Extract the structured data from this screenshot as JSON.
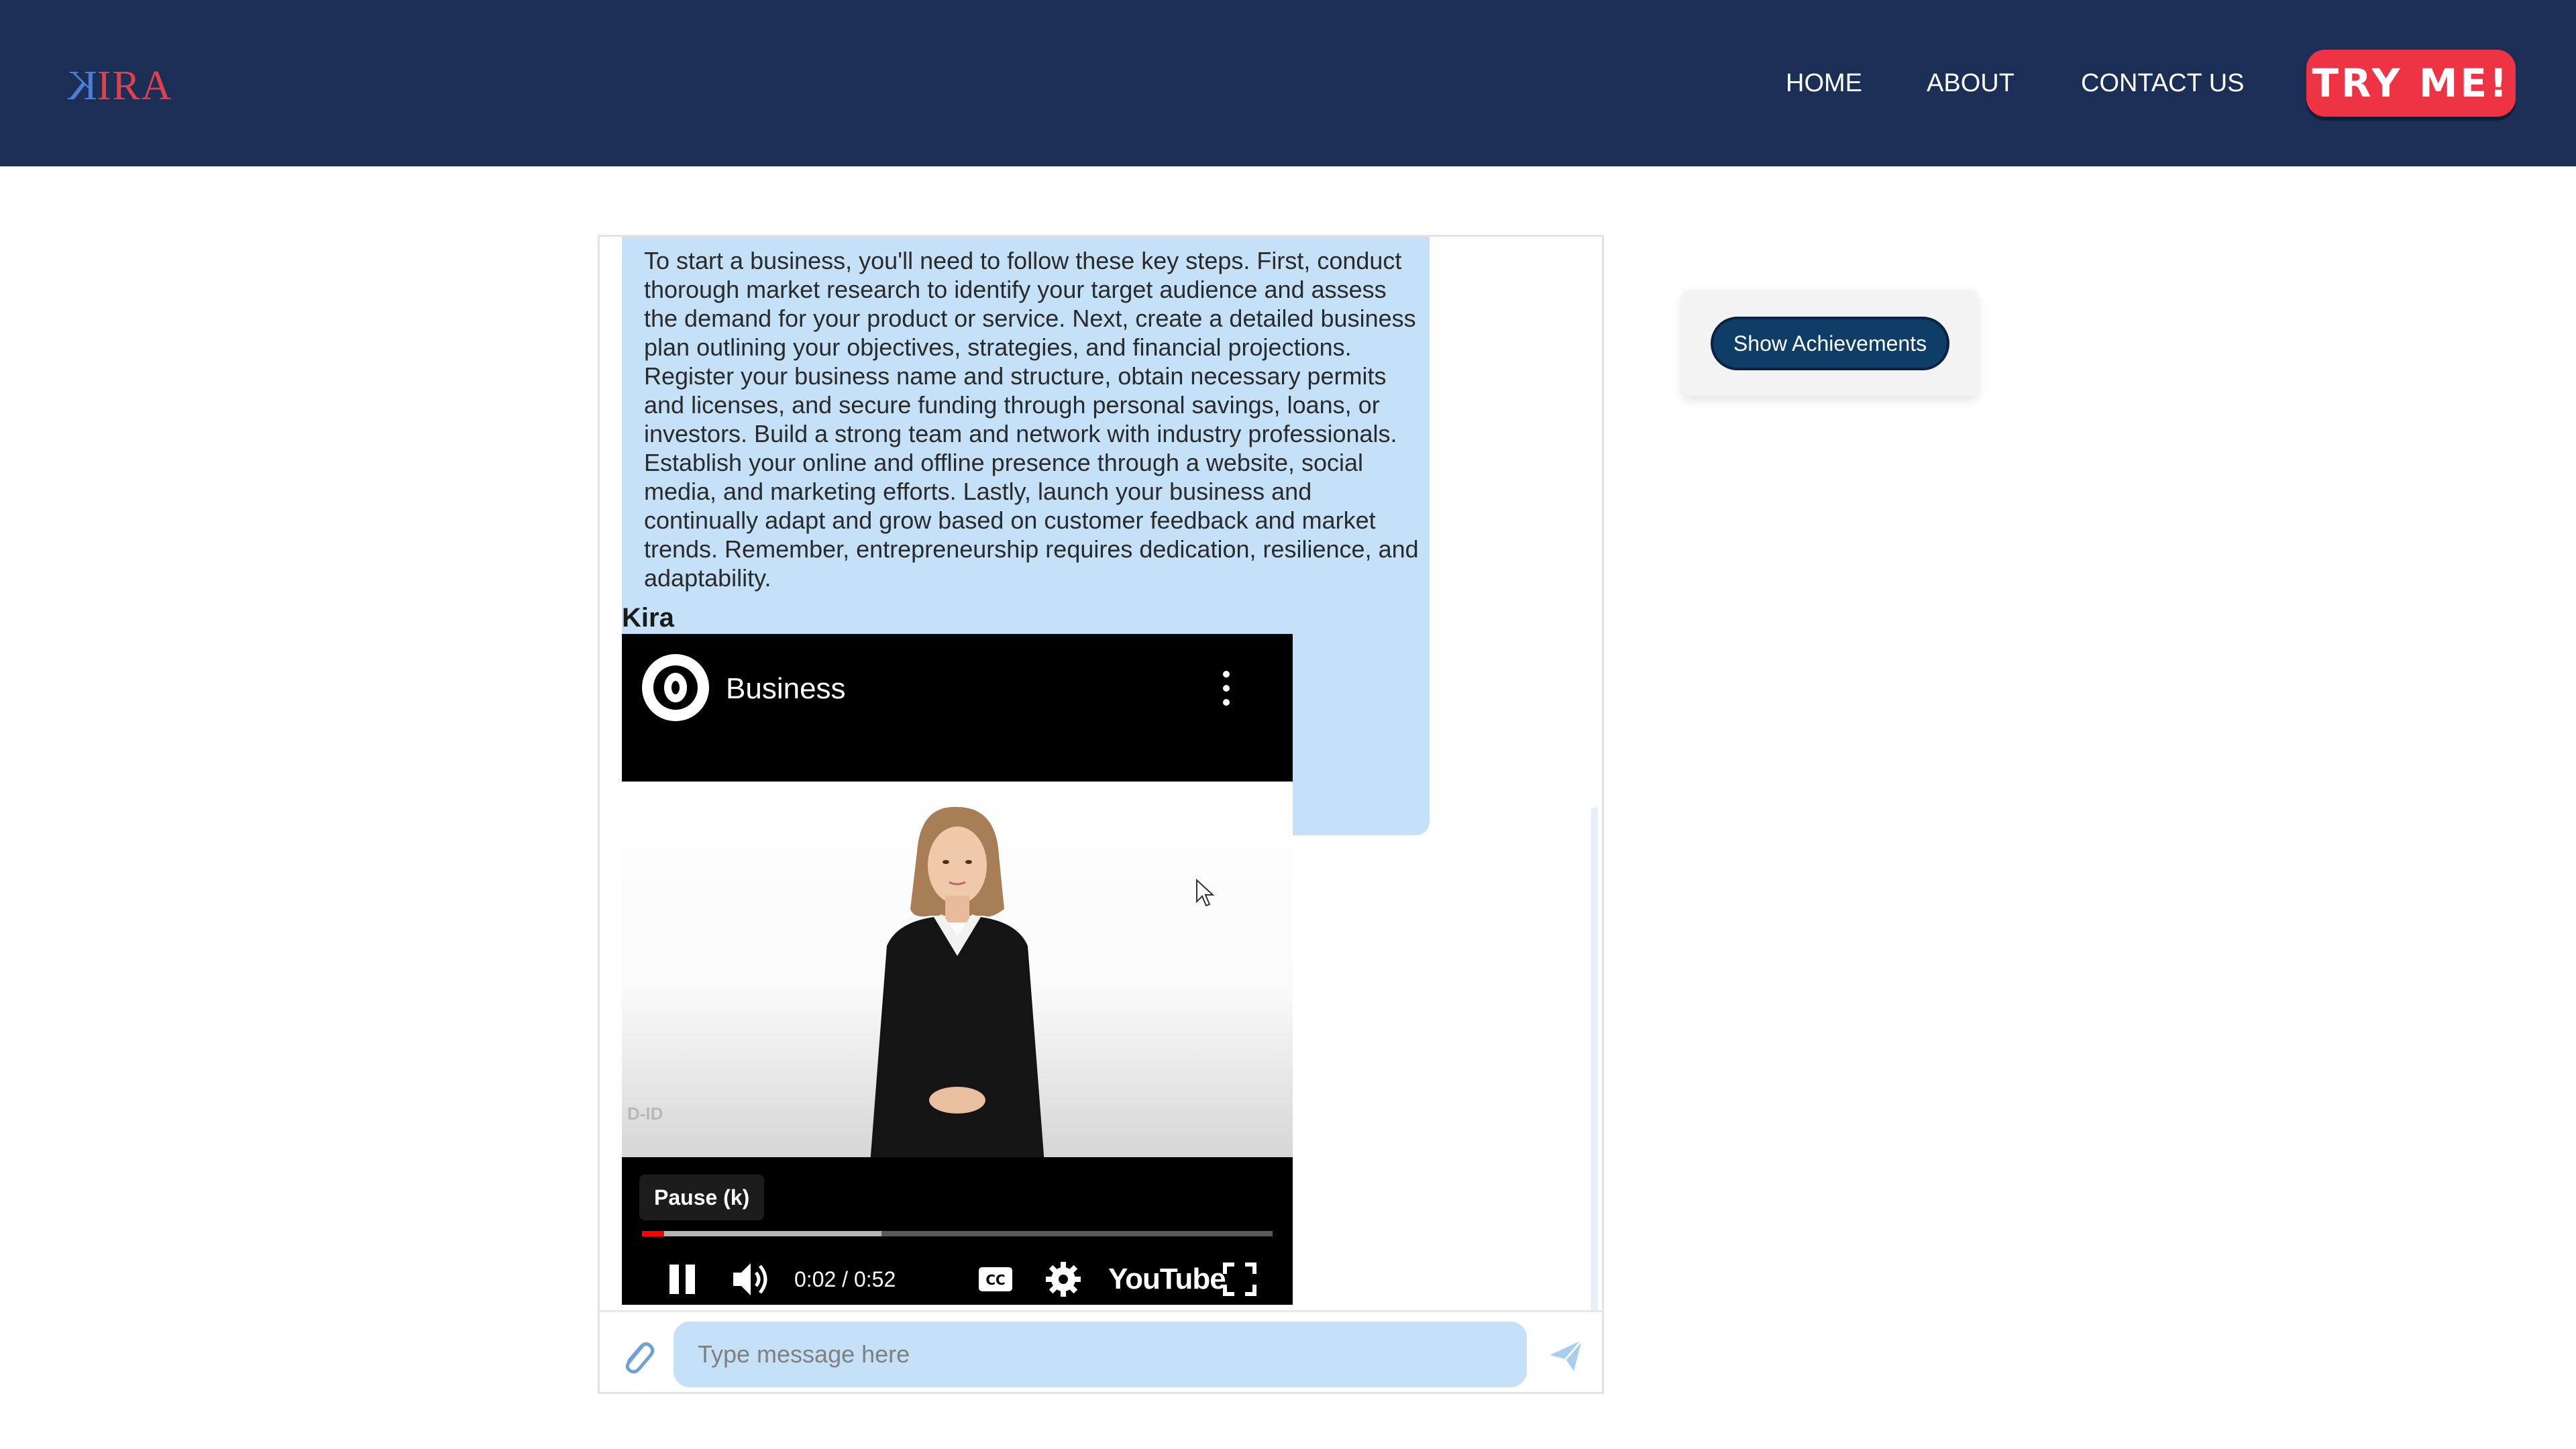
{
  "header": {
    "logo": {
      "k": "K",
      "rest": "IRA"
    },
    "nav": {
      "home": "HOME",
      "about": "ABOUT",
      "contact": "CONTACT US"
    },
    "cta_label": "TRY ME!"
  },
  "chat": {
    "bot_message": "To start a business, you'll need to follow these key steps. First, conduct thorough market research to identify your target audience and assess the demand for your product or service. Next, create a detailed business plan outlining your objectives, strategies, and financial projections. Register your business name and structure, obtain necessary permits and licenses, and secure funding through personal savings, loans, or investors. Build a strong team and network with industry professionals. Establish your online and offline presence through a website, social media, and marketing efforts. Lastly, launch your business and continually adapt and grow based on customer feedback and market trends. Remember, entrepreneurship requires dedication, resilience, and adaptability.",
    "sender": "Kira",
    "video": {
      "title": "Business",
      "tooltip": "Pause (k)",
      "time": "0:02 / 0:52",
      "progress_played": 0.035,
      "progress_buffered": 0.38,
      "brand": "YouTube",
      "watermark": "D-ID"
    },
    "input": {
      "placeholder": "Type message here",
      "value": ""
    }
  },
  "sidebar": {
    "achievements_label": "Show Achievements"
  },
  "colors": {
    "header_bg": "#1b2e55",
    "cta_bg": "#ee3344",
    "bubble_bg": "#c5e1f7",
    "achievements_btn": "#0e3d68",
    "progress_red": "#ff0000"
  },
  "icons": [
    "menu-dots-icon",
    "pause-icon",
    "volume-icon",
    "captions-icon",
    "gear-icon",
    "fullscreen-icon",
    "paperclip-icon",
    "send-icon",
    "cursor-icon"
  ]
}
